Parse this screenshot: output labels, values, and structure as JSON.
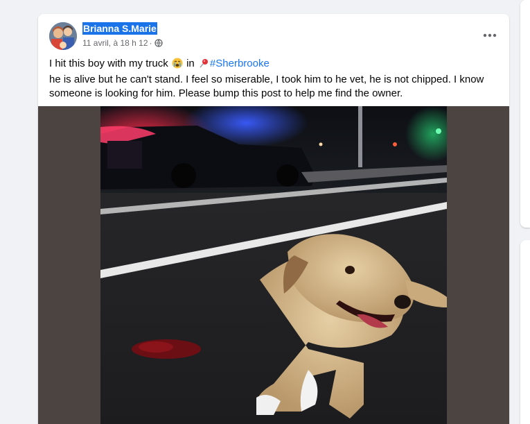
{
  "post": {
    "author": "Brianna S.Marie",
    "timestamp": "11 avril, à 18 h 12",
    "separator": "·",
    "privacy_icon": "globe-icon",
    "more_icon": "more-options-icon",
    "text": {
      "line1_start": "I hit this boy with my truck",
      "line1_emoji": "crying-face-emoji",
      "line1_in": "in",
      "line1_pin_icon": "round-pushpin-icon",
      "hashtag": "#Sherbrooke",
      "line2": "he is alive but he can't stand. I feel so miserable, I took him to he vet, he is not chipped. I know",
      "line3": "someone is looking for him. Please bump this post to help me find the owner."
    },
    "image": {
      "subject": "injured dog lying on road at night near police car",
      "frame_color": "#4c4440"
    }
  },
  "colors": {
    "page_bg": "#f0f2f5",
    "card_bg": "#ffffff",
    "name_highlight": "#1a73e8",
    "link": "#1877f2",
    "secondary_text": "#65676b"
  }
}
